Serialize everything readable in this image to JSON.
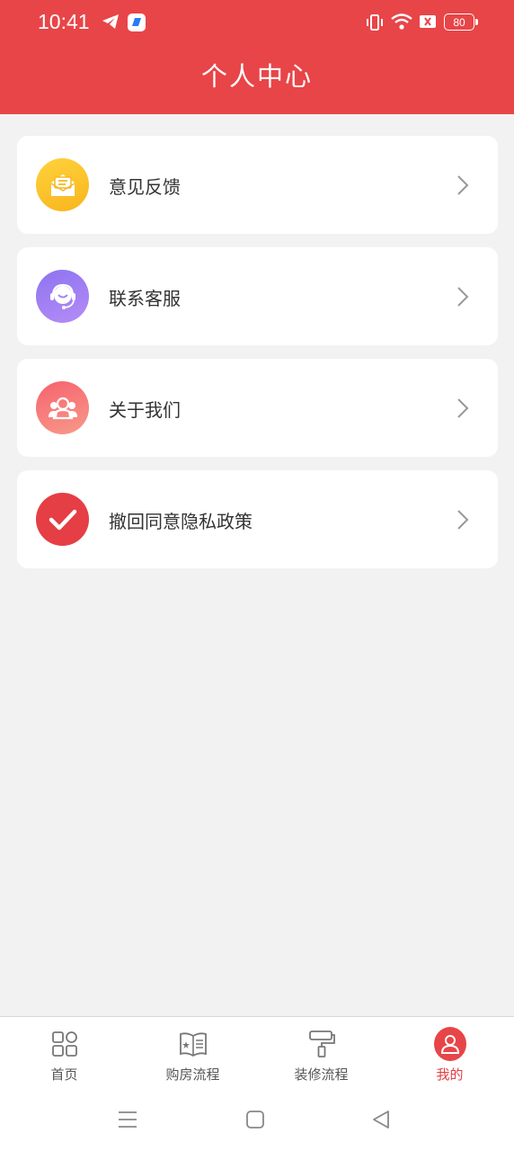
{
  "status_bar": {
    "time": "10:41",
    "battery": "80",
    "icons": [
      "telegram-icon",
      "app-icon",
      "vibrate-icon",
      "wifi-icon",
      "sim-off-icon",
      "battery-icon"
    ]
  },
  "header": {
    "title": "个人中心",
    "background": "#e84548"
  },
  "menu": [
    {
      "label": "意见反馈",
      "icon": "feedback-icon",
      "color": "#f9bf26"
    },
    {
      "label": "联系客服",
      "icon": "customer-service-icon",
      "color": "#9d7ff3"
    },
    {
      "label": "关于我们",
      "icon": "people-icon",
      "color": "#f7737a"
    },
    {
      "label": "撤回同意隐私政策",
      "icon": "check-icon",
      "color": "#e53e44"
    }
  ],
  "tabbar": {
    "tabs": [
      {
        "label": "首页",
        "icon": "home-grid-icon",
        "active": false
      },
      {
        "label": "购房流程",
        "icon": "book-icon",
        "active": false
      },
      {
        "label": "装修流程",
        "icon": "paint-roller-icon",
        "active": false
      },
      {
        "label": "我的",
        "icon": "user-icon",
        "active": true
      }
    ],
    "active_color": "#e53e44"
  },
  "system_nav": [
    "menu-icon",
    "home-square-icon",
    "back-icon"
  ]
}
